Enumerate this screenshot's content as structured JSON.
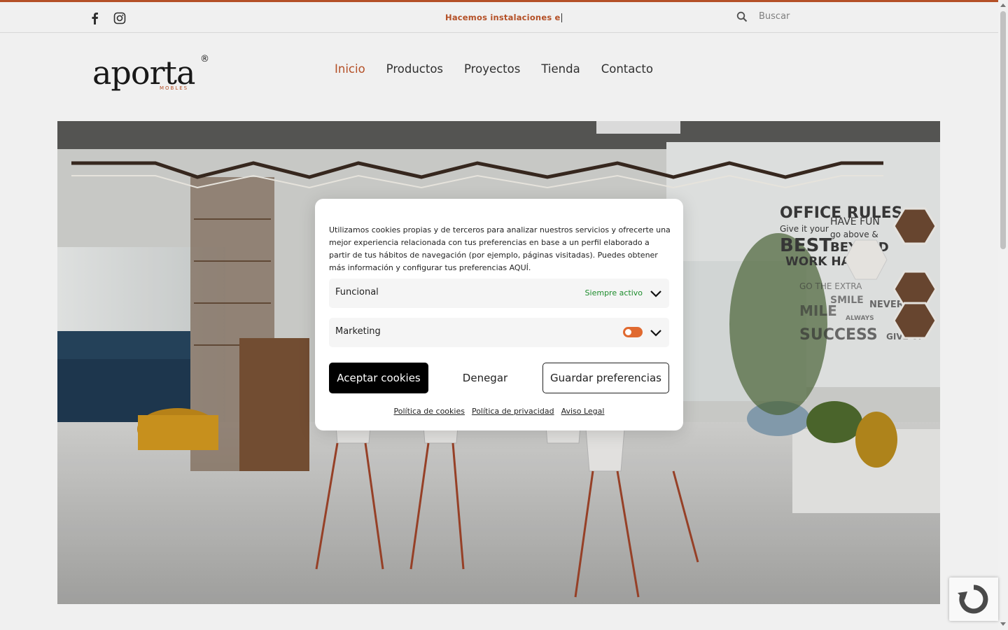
{
  "topbar": {
    "ticker_text": "Hacemos instalaciones e",
    "search_placeholder": "Buscar"
  },
  "logo": {
    "text": "aporta",
    "sub": "MOBLES",
    "mark": "®"
  },
  "nav": {
    "items": [
      "Inicio",
      "Productos",
      "Proyectos",
      "Tienda",
      "Contacto"
    ],
    "active": "Inicio"
  },
  "hero": {
    "wall_lines": [
      "OFFICE RULES",
      "Give it your",
      "HAVE FUN",
      "BEST",
      "go above &",
      "BEYOND",
      "WORK HARD",
      "GO THE EXTRA",
      "MILE",
      "SMILE",
      "ALWAYS",
      "SUCCESS",
      "NEVER",
      "GIVE UP"
    ]
  },
  "cookie_modal": {
    "text": "Utilizamos cookies propias y de terceros para analizar nuestros servicios y ofrecerte una mejor experiencia relacionada con tus preferencias en base a un perfil elaborado a partir de tus hábitos de navegación (por ejemplo, páginas visitadas). Puedes obtener más información y configurar tus preferencias AQUÍ.",
    "categories": [
      {
        "name": "Funcional",
        "status": "Siempre activo"
      },
      {
        "name": "Marketing",
        "toggle": "off"
      }
    ],
    "buttons": {
      "accept": "Aceptar cookies",
      "deny": "Denegar",
      "save": "Guardar preferencias"
    },
    "links": [
      "Política de cookies",
      "Política de privacidad",
      "Aviso Legal"
    ]
  },
  "colors": {
    "accent": "#c0562a",
    "toggle": "#e0692f",
    "status_green": "#1d8c2c"
  }
}
